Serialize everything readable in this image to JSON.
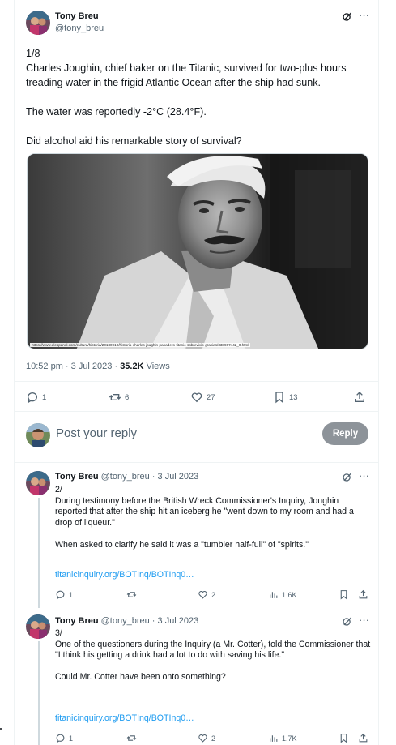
{
  "main_tweet": {
    "author_name": "Tony Breu",
    "author_handle": "@tony_breu",
    "text": "1/8\nCharles Joughin, chief baker on the Titanic, survived for two-plus hours treading water in the frigid Atlantic Ocean after the ship had sunk.\n\nThe water was reportedly -2°C (28.4°F).\n\nDid alcohol aid his remarkable story of survival?",
    "media_caption_url": "https://www.elespanol.com/cultura/historia/20180919/historia-charles-joughin-panadero-titanic-sobrevivio-gracias/338967442_0.html",
    "time": "10:52 pm · 3 Jul 2023 · ",
    "views_count": "35.2K",
    "views_label": " Views",
    "counts": {
      "replies": "1",
      "reposts": "6",
      "likes": "27",
      "bookmarks": "13"
    }
  },
  "reply_box": {
    "placeholder": "Post your reply",
    "button_label": "Reply"
  },
  "thread": [
    {
      "author_name": "Tony Breu",
      "author_handle": "@tony_breu",
      "date": "· 3 Jul 2023",
      "text": "2/\nDuring testimony before the British Wreck Commissioner's Inquiry, Joughin reported that after the ship hit an iceberg he \"went down to my room and had a drop of liqueur.\"\n\nWhen asked to clarify he said it was a \"tumbler half-full\" of \"spirits.\"",
      "link": "titanicinquiry.org/BOTInq/BOTInq0…",
      "counts": {
        "replies": "1",
        "reposts": "",
        "likes": "2",
        "views": "1.6K"
      }
    },
    {
      "author_name": "Tony Breu",
      "author_handle": "@tony_breu",
      "date": "· 3 Jul 2023",
      "text": "3/\nOne of the questioners during the Inquiry (a Mr. Cotter), told the Commissioner that \"I think his getting a drink had a lot to do with saving his life.\"\n\nCould Mr. Cotter have been onto something?",
      "link": "titanicinquiry.org/BOTInq/BOTInq0…",
      "counts": {
        "replies": "1",
        "reposts": "",
        "likes": "2",
        "views": "1.7K"
      }
    }
  ],
  "icons": {
    "more": "more-horizontal-icon",
    "grok": "grok-icon",
    "reply": "reply-icon",
    "repost": "repost-icon",
    "like": "heart-icon",
    "bookmark": "bookmark-icon",
    "share": "share-icon",
    "views": "analytics-icon"
  },
  "colors": {
    "text_primary": "#0f1419",
    "text_secondary": "#536471",
    "link": "#1d9bf0",
    "reply_button_disabled": "#8d9399",
    "border": "#eff3f4"
  }
}
